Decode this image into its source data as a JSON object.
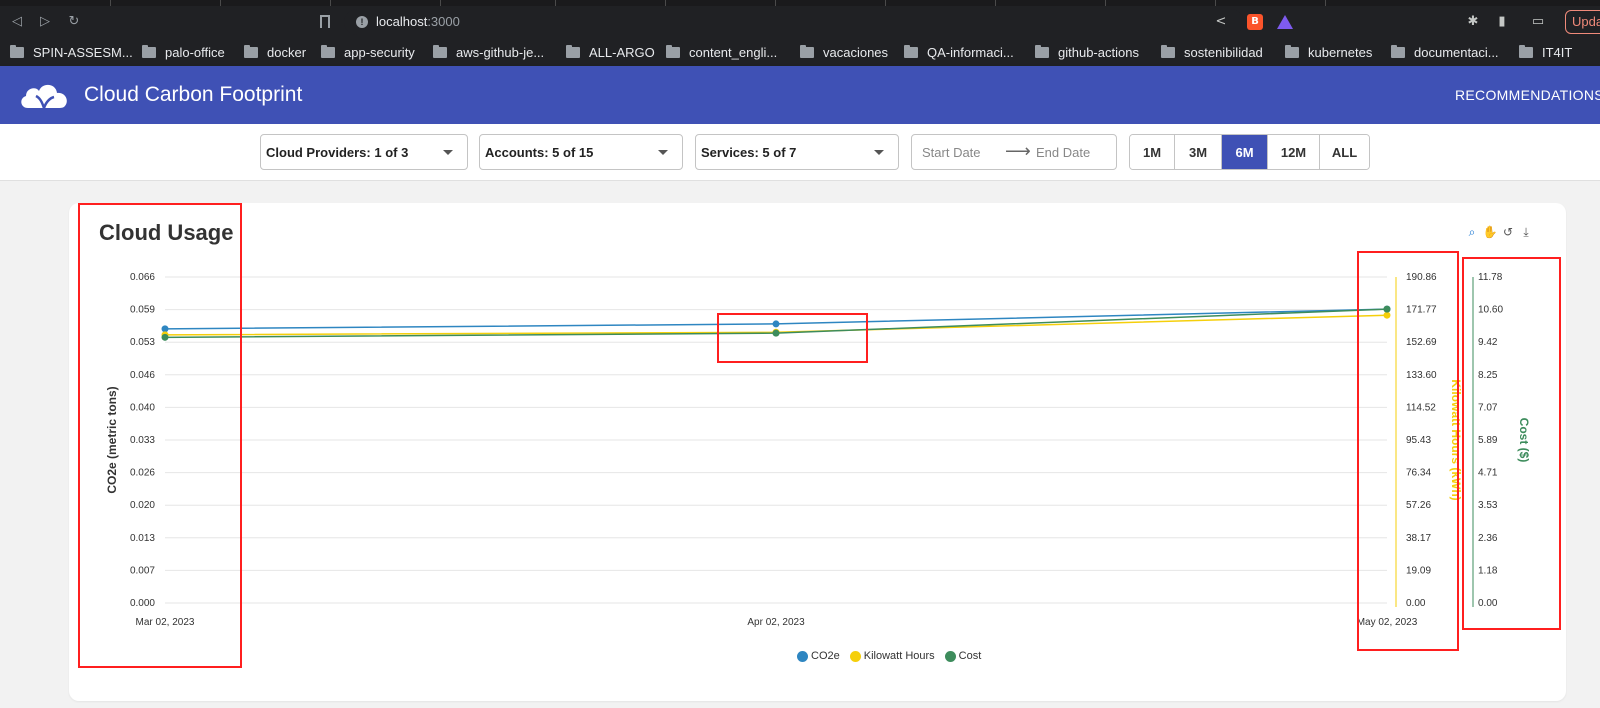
{
  "browser": {
    "url_host": "localhost",
    "url_port": ":3000",
    "update_label": "Upda",
    "bookmarks": [
      "SPIN-ASSESM...",
      "palo-office",
      "docker",
      "app-security",
      "aws-github-je...",
      "ALL-ARGO",
      "content_engli...",
      "vacaciones",
      "QA-informaci...",
      "github-actions",
      "sostenibilidad",
      "kubernetes",
      "documentaci...",
      "IT4IT"
    ]
  },
  "header": {
    "title": "Cloud Carbon Footprint",
    "recommendations_label": "RECOMMENDATIONS"
  },
  "filters": {
    "cloud_providers": "Cloud Providers: 1 of 3",
    "accounts": "Accounts: 5 of 15",
    "services": "Services: 5 of 7",
    "start_date_placeholder": "Start Date",
    "end_date_placeholder": "End Date",
    "ranges": [
      "1M",
      "3M",
      "6M",
      "12M",
      "ALL"
    ],
    "active_range": "6M"
  },
  "card": {
    "title": "Cloud Usage"
  },
  "chart_data": {
    "type": "line",
    "x": [
      "Mar 02, 2023",
      "Apr 02, 2023",
      "May 02, 2023"
    ],
    "series": [
      {
        "name": "CO2e",
        "axis": "left",
        "color": "#2e86c1",
        "values": [
          0.0555,
          0.0565,
          0.0595
        ]
      },
      {
        "name": "Kilowatt Hours",
        "axis": "right1",
        "color": "#f5cf0b",
        "values": [
          157.0,
          158.5,
          168.5
        ]
      },
      {
        "name": "Cost",
        "axis": "right2",
        "color": "#3d8c5c",
        "values": [
          9.6,
          9.75,
          10.62
        ]
      }
    ],
    "axes": {
      "left": {
        "label": "CO2e (metric tons)",
        "ticks": [
          "0.000",
          "0.007",
          "0.013",
          "0.020",
          "0.026",
          "0.033",
          "0.040",
          "0.046",
          "0.053",
          "0.059",
          "0.066"
        ],
        "range": [
          0,
          0.066
        ],
        "color": "#333333"
      },
      "right1": {
        "label": "Kilowatt Hours (kWh)",
        "ticks": [
          "0.00",
          "19.09",
          "38.17",
          "57.26",
          "76.34",
          "95.43",
          "114.52",
          "133.60",
          "152.69",
          "171.77",
          "190.86"
        ],
        "range": [
          0,
          190.86
        ],
        "color": "#f5cf0b"
      },
      "right2": {
        "label": "Cost ($)",
        "ticks": [
          "0.00",
          "1.18",
          "2.36",
          "3.53",
          "4.71",
          "5.89",
          "7.07",
          "8.25",
          "9.42",
          "10.60",
          "11.78"
        ],
        "range": [
          0,
          11.78
        ],
        "color": "#3d8c5c"
      }
    },
    "grid": true,
    "legend_position": "bottom"
  }
}
